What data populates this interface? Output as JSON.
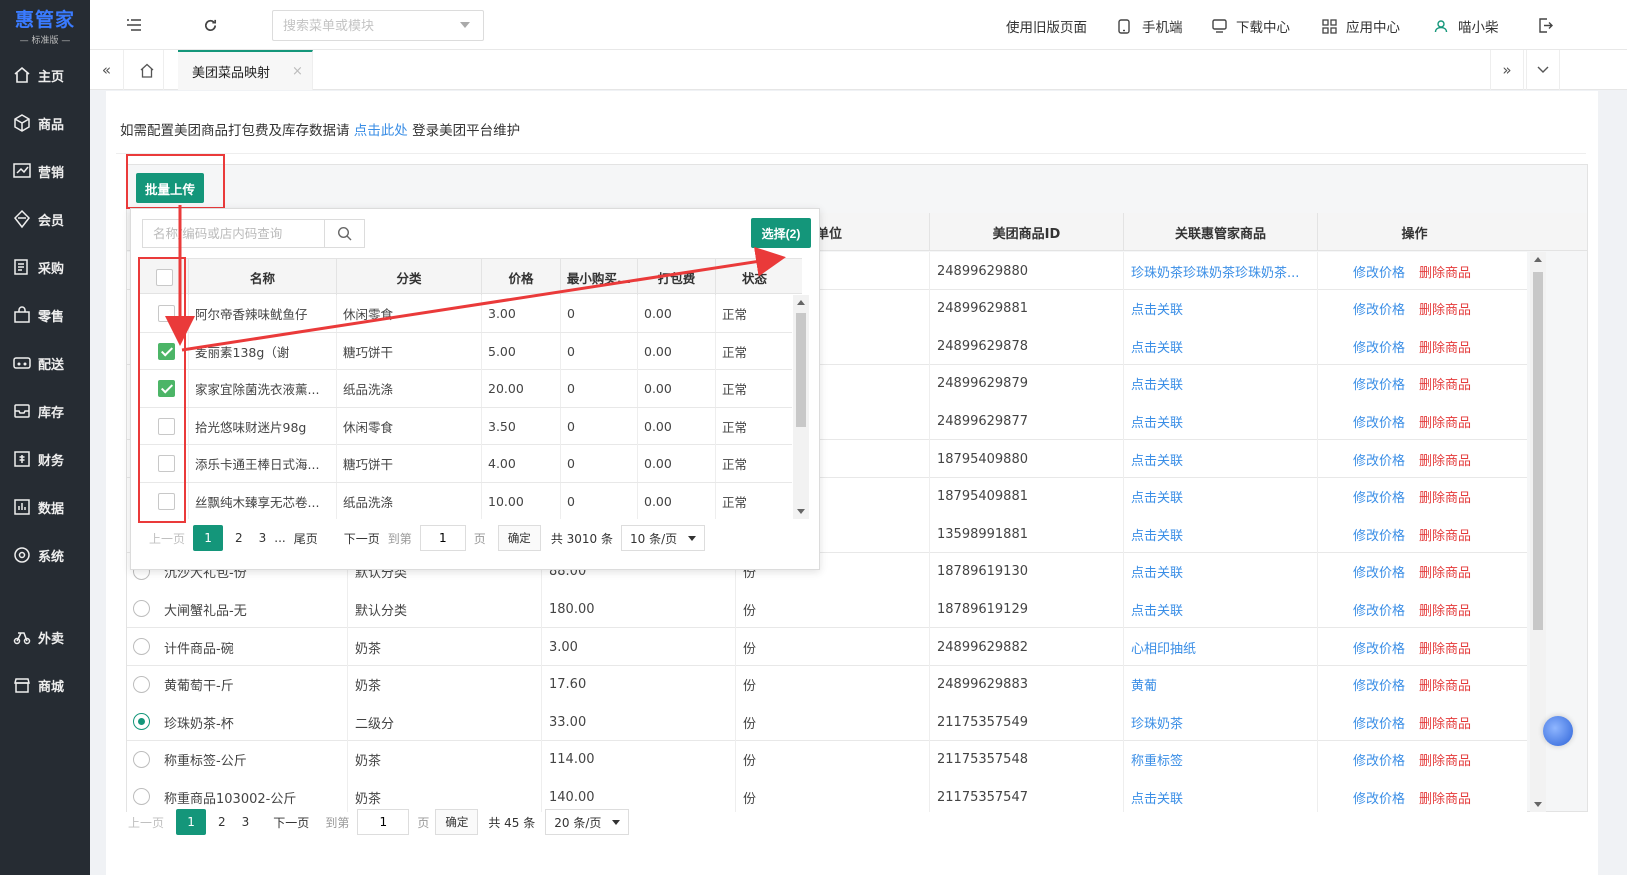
{
  "app": {
    "brand": "惠管家",
    "edition": "— 标准版 —"
  },
  "colors": {
    "accent": "#14967a",
    "sidebar_bg": "#262c33",
    "link": "#3a8ee6",
    "danger": "#e43b3b",
    "annotation_red": "#ea3a3a",
    "checked_green": "#4cb567"
  },
  "sidebar": {
    "items": [
      {
        "label": "主页",
        "icon": "home-icon"
      },
      {
        "label": "商品",
        "icon": "box-icon"
      },
      {
        "label": "营销",
        "icon": "chart-icon"
      },
      {
        "label": "会员",
        "icon": "diamond-icon"
      },
      {
        "label": "采购",
        "icon": "receipt-icon"
      },
      {
        "label": "零售",
        "icon": "bag-icon"
      },
      {
        "label": "配送",
        "icon": "truck-icon"
      },
      {
        "label": "库存",
        "icon": "inbox-icon"
      },
      {
        "label": "财务",
        "icon": "money-icon"
      },
      {
        "label": "数据",
        "icon": "bars-icon"
      },
      {
        "label": "系统",
        "icon": "gear-icon"
      },
      {
        "label": "外卖",
        "icon": "delivery-icon"
      },
      {
        "label": "商城",
        "icon": "store-icon"
      }
    ]
  },
  "topbar": {
    "search_placeholder": "搜索菜单或模块",
    "links": {
      "old_version": "使用旧版页面",
      "mobile": "手机端",
      "download": "下载中心",
      "apps": "应用中心",
      "user": "喵小柴"
    }
  },
  "tabs": {
    "active": "美团菜品映射",
    "close": "×"
  },
  "notice": {
    "before": "如需配置美团商品打包费及库存数据请",
    "link": "点击此处",
    "after": "登录美团平台维护"
  },
  "batch_upload_label": "批量上传",
  "main_table": {
    "headers": {
      "unit": "单位",
      "meituan_id": "美团商品ID",
      "linked": "关联惠管家商品",
      "ops": "操作"
    },
    "edit_label": "修改价格",
    "delete_label": "删除商品",
    "rows": [
      {
        "name": "",
        "category": "",
        "price": "",
        "unit": "",
        "id": "24899629880",
        "linked": "珍珠奶茶珍珠奶茶珍珠奶茶...",
        "selected": false
      },
      {
        "name": "",
        "category": "",
        "price": "",
        "unit": "",
        "id": "24899629881",
        "linked": "点击关联",
        "selected": false
      },
      {
        "name": "",
        "category": "",
        "price": "",
        "unit": "",
        "id": "24899629878",
        "linked": "点击关联",
        "selected": false
      },
      {
        "name": "",
        "category": "",
        "price": "",
        "unit": "",
        "id": "24899629879",
        "linked": "点击关联",
        "selected": false
      },
      {
        "name": "",
        "category": "",
        "price": "",
        "unit": "",
        "id": "24899629877",
        "linked": "点击关联",
        "selected": false
      },
      {
        "name": "",
        "category": "",
        "price": "",
        "unit": "",
        "id": "18795409880",
        "linked": "点击关联",
        "selected": false
      },
      {
        "name": "",
        "category": "",
        "price": "",
        "unit": "",
        "id": "18795409881",
        "linked": "点击关联",
        "selected": false
      },
      {
        "name": "",
        "category": "",
        "price": "",
        "unit": "",
        "id": "13598991881",
        "linked": "点击关联",
        "selected": false
      },
      {
        "name": "沉沙大礼包-份",
        "category": "默认分类",
        "price": "88.00",
        "unit": "份",
        "id": "18789619130",
        "linked": "点击关联",
        "selected": false
      },
      {
        "name": "大闸蟹礼品-无",
        "category": "默认分类",
        "price": "180.00",
        "unit": "份",
        "id": "18789619129",
        "linked": "点击关联",
        "selected": false
      },
      {
        "name": "计件商品-碗",
        "category": "奶茶",
        "price": "3.00",
        "unit": "份",
        "id": "24899629882",
        "linked": "心相印抽纸",
        "selected": false
      },
      {
        "name": "黄葡萄干-斤",
        "category": "奶茶",
        "price": "17.60",
        "unit": "份",
        "id": "24899629883",
        "linked": "黄葡",
        "selected": false
      },
      {
        "name": "珍珠奶茶-杯",
        "category": "二级分",
        "price": "33.00",
        "unit": "份",
        "id": "21175357549",
        "linked": "珍珠奶茶",
        "selected": true
      },
      {
        "name": "称重标签-公斤",
        "category": "奶茶",
        "price": "114.00",
        "unit": "份",
        "id": "21175357548",
        "linked": "称重标签",
        "selected": false
      },
      {
        "name": "称重商品103002-公斤",
        "category": "奶茶",
        "price": "140.00",
        "unit": "份",
        "id": "21175357547",
        "linked": "点击关联",
        "selected": false
      }
    ],
    "pager": {
      "prev": "上一页",
      "pages": [
        "1",
        "2",
        "3"
      ],
      "next": "下一页",
      "goto": "到第",
      "page_value": "1",
      "page_unit": "页",
      "ok": "确定",
      "total": "共 45 条",
      "size": "20 条/页"
    }
  },
  "popup": {
    "search_placeholder": "名称/编码或店内码查询",
    "select_label": "选择(2)",
    "headers": {
      "name": "名称",
      "category": "分类",
      "price": "价格",
      "min_buy": "最小购买...",
      "pack_fee": "打包费",
      "status": "状态"
    },
    "rows": [
      {
        "checked": false,
        "name": "阿尔帝香辣味鱿鱼仔",
        "category": "休闲零食",
        "price": "3.00",
        "min": "0",
        "fee": "0.00",
        "status": "正常"
      },
      {
        "checked": true,
        "name": "麦丽素138g（谢",
        "category": "糖巧饼干",
        "price": "5.00",
        "min": "0",
        "fee": "0.00",
        "status": "正常"
      },
      {
        "checked": true,
        "name": "家家宜除菌洗衣液薰...",
        "category": "纸品洗涤",
        "price": "20.00",
        "min": "0",
        "fee": "0.00",
        "status": "正常"
      },
      {
        "checked": false,
        "name": "拾光悠味财迷片98g",
        "category": "休闲零食",
        "price": "3.50",
        "min": "0",
        "fee": "0.00",
        "status": "正常"
      },
      {
        "checked": false,
        "name": "添乐卡通王棒日式海...",
        "category": "糖巧饼干",
        "price": "4.00",
        "min": "0",
        "fee": "0.00",
        "status": "正常"
      },
      {
        "checked": false,
        "name": "丝飘纯木臻享无芯卷...",
        "category": "纸品洗涤",
        "price": "10.00",
        "min": "0",
        "fee": "0.00",
        "status": "正常"
      }
    ],
    "pager": {
      "prev": "上一页",
      "pages": [
        "1",
        "2",
        "3"
      ],
      "ellipsis": "...",
      "last": "尾页",
      "next": "下一页",
      "goto": "到第",
      "page_value": "1",
      "page_unit": "页",
      "ok": "确定",
      "total": "共 3010 条",
      "size": "10 条/页"
    }
  }
}
